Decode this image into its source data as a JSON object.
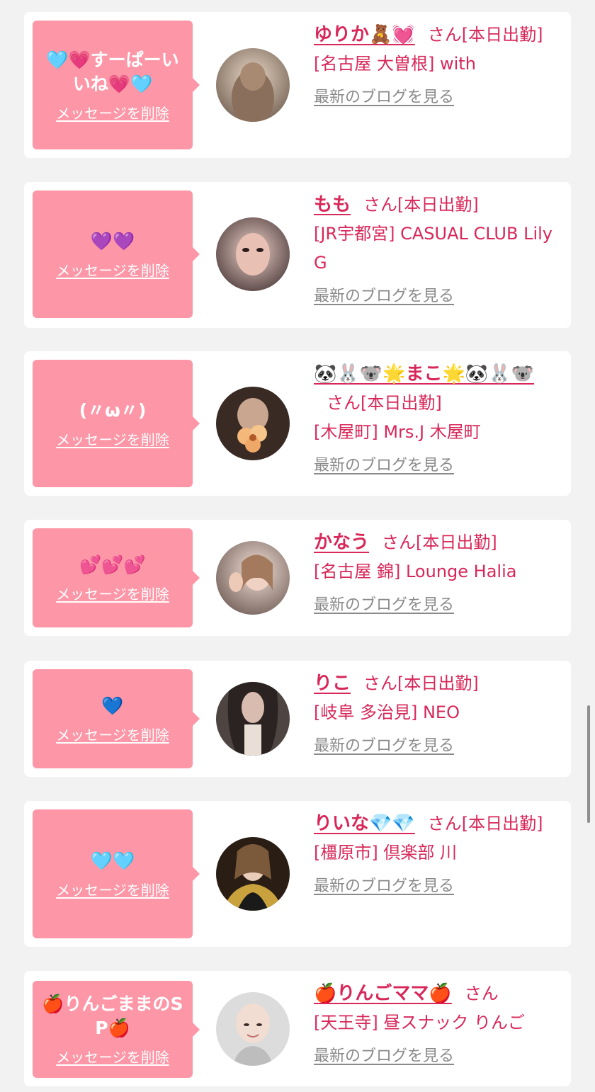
{
  "cards": [
    {
      "message": "🩵💗すーぱーいいね💗🩵",
      "delete_label": "メッセージを削除",
      "avatar": "avatar-photo",
      "name": "ゆりか🧸💓",
      "san_status": "さん[本日出勤]",
      "shop": "[名古屋 大曽根] with",
      "blog_label": "最新のブログを見る"
    },
    {
      "message": "💜💜",
      "delete_label": "メッセージを削除",
      "avatar": "avatar-photo",
      "name": "もも",
      "san_status": "さん[本日出勤]",
      "shop": "[JR宇都宮] CASUAL CLUB Lily G",
      "blog_label": "最新のブログを見る"
    },
    {
      "message": "(〃ω〃)",
      "delete_label": "メッセージを削除",
      "avatar": "avatar-photo",
      "name": "🐼🐰🐨🌟まこ🌟🐼🐰🐨",
      "san_status": "さん[本日出勤]",
      "shop": "[木屋町] Mrs.J 木屋町",
      "blog_label": "最新のブログを見る"
    },
    {
      "message": "💕💕💕",
      "delete_label": "メッセージを削除",
      "avatar": "avatar-photo",
      "name": "かなう",
      "san_status": "さん[本日出勤]",
      "shop": "[名古屋 錦] Lounge Halia",
      "blog_label": "最新のブログを見る"
    },
    {
      "message": "💙",
      "delete_label": "メッセージを削除",
      "avatar": "avatar-photo",
      "name": "りこ",
      "san_status": "さん[本日出勤]",
      "shop": "[岐阜 多治見] NEO",
      "blog_label": "最新のブログを見る"
    },
    {
      "message": "🩵🩵",
      "delete_label": "メッセージを削除",
      "avatar": "avatar-photo",
      "name": "りいな💎💎",
      "san_status": "さん[本日出勤]",
      "shop": "[橿原市] 倶楽部 川",
      "blog_label": "最新のブログを見る"
    },
    {
      "message": "🍎りんごままのSP🍎",
      "delete_label": "メッセージを削除",
      "avatar": "avatar-photo",
      "name": "🍎りんごママ🍎",
      "san_status": "さん",
      "shop": "[天王寺] 昼スナック りんご",
      "blog_label": "最新のブログを見る"
    }
  ]
}
